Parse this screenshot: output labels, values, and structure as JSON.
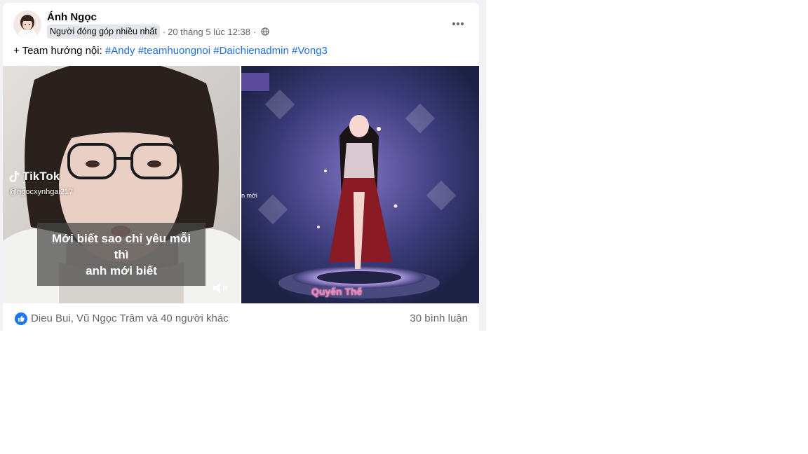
{
  "post": {
    "author": "Ánh Ngọc",
    "badge": "Người đóng góp nhiều nhất",
    "timestamp": "20 tháng 5 lúc 12:38",
    "separator_1": "·",
    "separator_2": "·",
    "privacy_icon": "globe-icon",
    "more_icon": "more-options-icon",
    "caption_prefix": "+ Team hướng nội:",
    "hashtags": [
      "#Andy",
      "#teamhuongnoi",
      "#Daichienadmin",
      "#Vong3"
    ]
  },
  "media": {
    "left": {
      "watermark": "TikTok",
      "username": "@ngocxynhgai217",
      "subtitle_lines": [
        "Mới biết sao chỉ yêu mỗi",
        "thì",
        "anh mới biết"
      ],
      "mute_icon": "muted-speaker-icon"
    },
    "right": {
      "character_name": "Quyến Thế",
      "side_text": "n mới"
    }
  },
  "reactions": {
    "icon": "like-icon",
    "names": "Dieu Bui, Vũ Ngọc Trâm và 40 người khác",
    "comments": "30 bình luận"
  },
  "colors": {
    "link": "#216fdb",
    "muted_text": "#65676b",
    "like_blue": "#1877f2",
    "badge_bg": "#e4e6eb"
  }
}
